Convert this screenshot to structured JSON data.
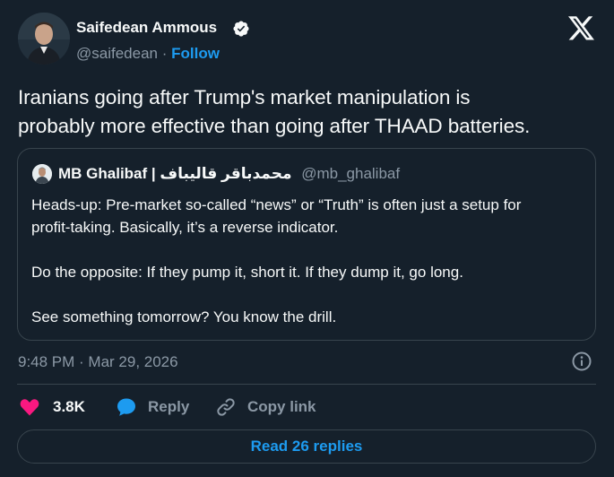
{
  "author": {
    "name": "Saifedean Ammous",
    "handle": "@saifedean",
    "separator": "·",
    "follow_label": "Follow"
  },
  "tweet": {
    "text_lines": [
      "Iranians going after Trump's market manipulation is",
      "probably more effective than going after THAAD batteries."
    ]
  },
  "quoted_tweet": {
    "name": "MB Ghalibaf | محمدباقر قالیباف",
    "handle": "@mb_ghalibaf",
    "lines": [
      "Heads-up: Pre-market so-called “news” or “Truth” is often just a setup for",
      "profit-taking. Basically, it’s a reverse indicator.",
      "Do the opposite: If they pump it, short it. If they dump it, go long.",
      "See something tomorrow? You know the drill."
    ]
  },
  "timestamp": "9:48 PM · Mar 29, 2026",
  "actions": {
    "like_count": "3.8K",
    "reply_label": "Reply",
    "copy_link_label": "Copy link"
  },
  "read_replies_label": "Read 26 replies",
  "icons": {
    "verified": "verified-badge-icon",
    "x_logo": "x-logo-icon",
    "info": "info-icon",
    "heart": "heart-icon",
    "reply": "reply-bubble-icon",
    "link": "link-icon"
  },
  "colors": {
    "background": "#15202b",
    "accent": "#1d9bf0",
    "like": "#f91880",
    "muted": "#8b98a5",
    "border": "#38444d"
  }
}
